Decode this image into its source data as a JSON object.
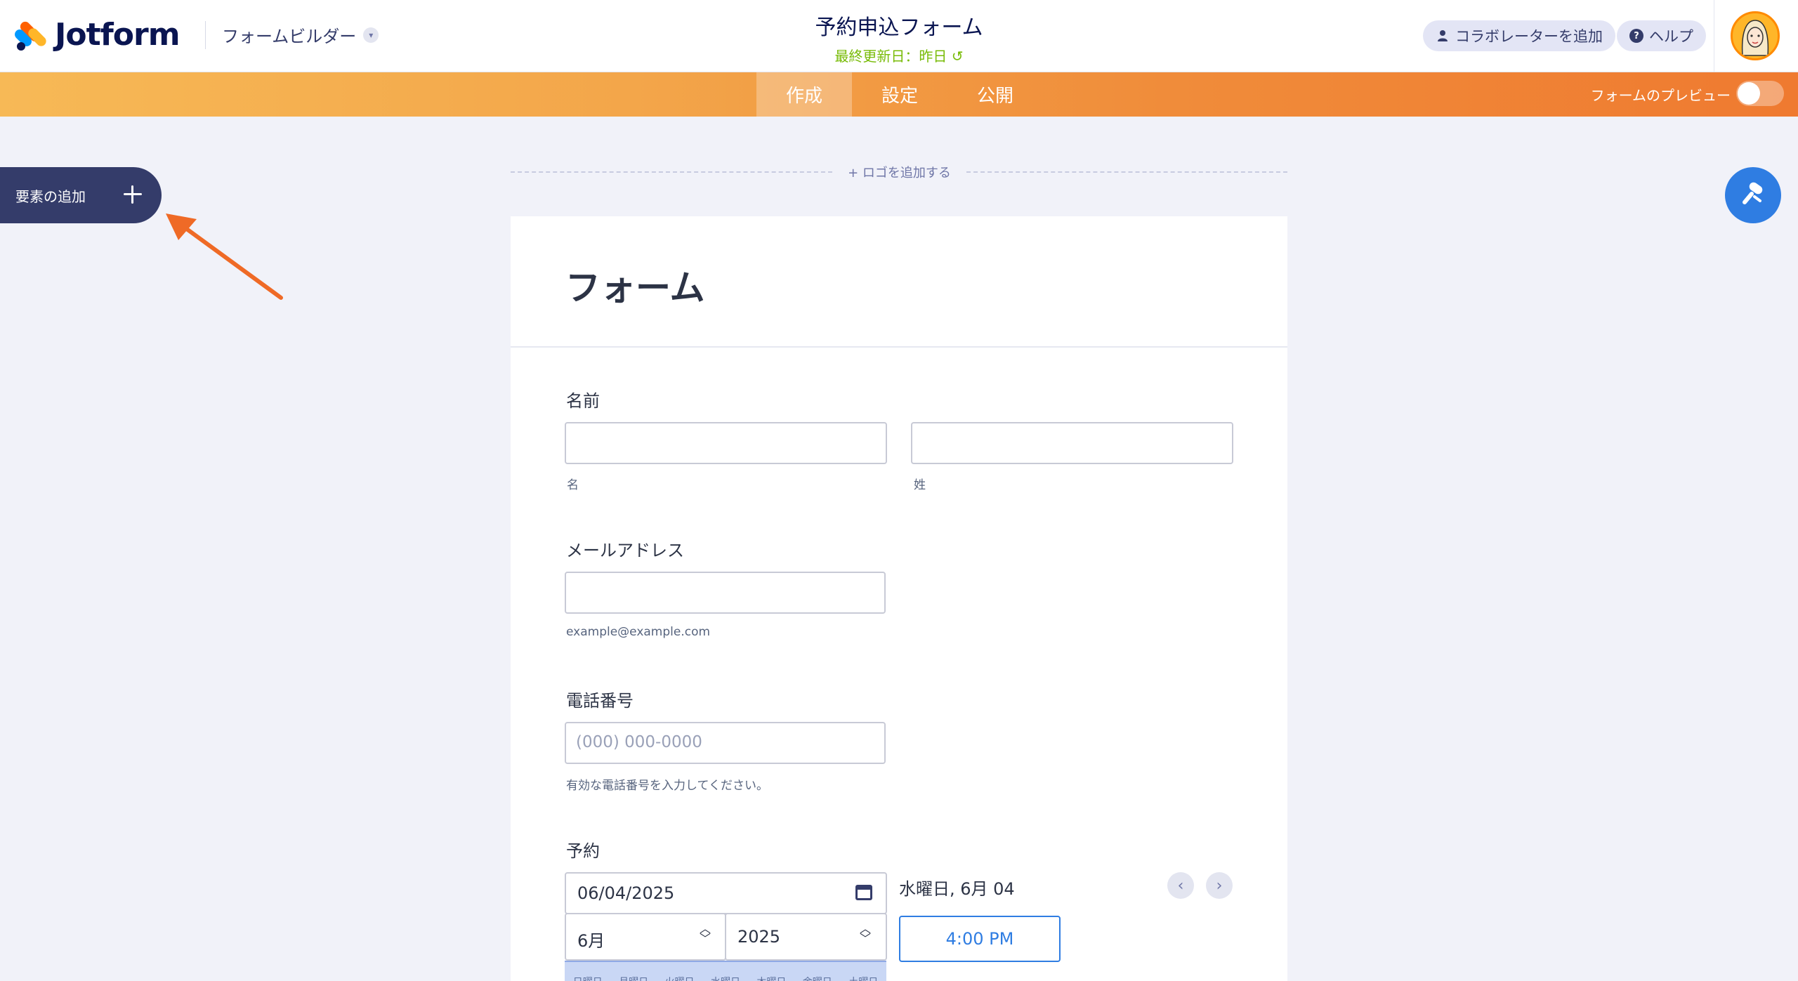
{
  "header": {
    "brand": "Jotform",
    "builder_menu": "フォームビルダー",
    "form_title": "予約申込フォーム",
    "last_updated": "最終更新日：昨日",
    "collab_button": "コラボレーターを追加",
    "help_button": "ヘルプ"
  },
  "nav": {
    "tabs": [
      {
        "label": "作成",
        "active": true
      },
      {
        "label": "設定",
        "active": false
      },
      {
        "label": "公開",
        "active": false
      }
    ],
    "preview_label": "フォームのプレビュー"
  },
  "add_element": {
    "label": "要素の追加"
  },
  "canvas": {
    "add_logo": "+ ロゴを追加する"
  },
  "form": {
    "heading": "フォーム",
    "name": {
      "label": "名前",
      "first_sublabel": "名",
      "last_sublabel": "姓"
    },
    "email": {
      "label": "メールアドレス",
      "sublabel": "example@example.com"
    },
    "phone": {
      "label": "電話番号",
      "placeholder": "(000) 000-0000",
      "sublabel": "有効な電話番号を入力してください。"
    },
    "appointment": {
      "label": "予約",
      "date_value": "06/04/2025",
      "month_value": "6月",
      "year_value": "2025",
      "selected_day": "水曜日, 6月 04",
      "time_slot": "4:00 PM",
      "weekdays": [
        "日曜日",
        "月曜日",
        "火曜日",
        "水曜日",
        "木曜日",
        "金曜日",
        "土曜日"
      ]
    }
  },
  "colors": {
    "accent": "#2f7de2",
    "nav_orange": "#ef7a30",
    "dark": "#343c6a",
    "update_green": "#78bb07"
  }
}
